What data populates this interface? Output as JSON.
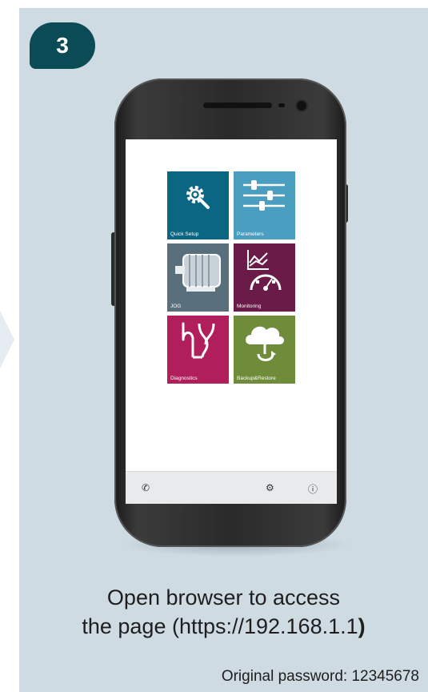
{
  "step": {
    "number": "3"
  },
  "tiles": [
    {
      "label": "Quick Setup",
      "color": "#0b6683",
      "icon": "gear-wrench-icon"
    },
    {
      "label": "Parameters",
      "color": "#4a9ebf",
      "icon": "sliders-icon"
    },
    {
      "label": "JOG",
      "color": "#5a6f7c",
      "icon": "motor-icon"
    },
    {
      "label": "Monitoring",
      "color": "#6b1b47",
      "icon": "chart-gauge-icon"
    },
    {
      "label": "Diagnostics",
      "color": "#b01f5c",
      "icon": "stethoscope-icon"
    },
    {
      "label": "Backup&Restore",
      "color": "#6f8c3b",
      "icon": "cloud-restore-icon"
    }
  ],
  "nav": {
    "phone": "phone-icon",
    "settings": "settings-icon",
    "info": "info-icon"
  },
  "caption": {
    "line1": "Open browser to access",
    "line2_text": "the page (https://192.168.1.1",
    "line2_paren": ")"
  },
  "password": "Original password: 12345678"
}
